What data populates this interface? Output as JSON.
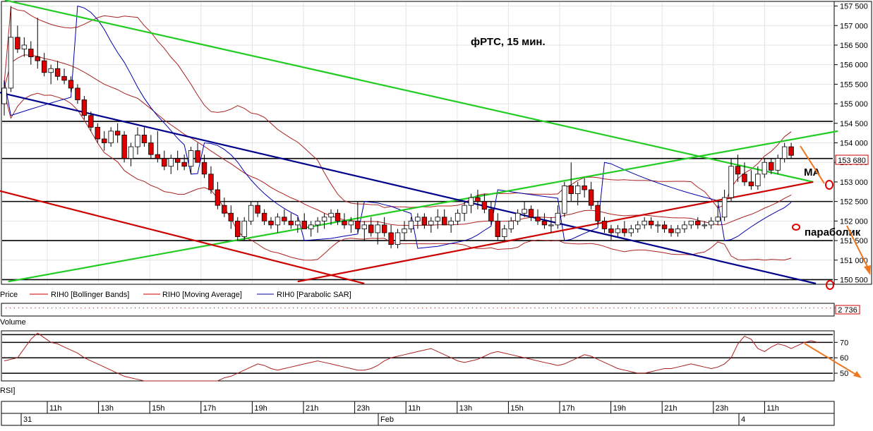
{
  "chart_data": {
    "type": "candlestick",
    "title": "фРТС,   15 мин.",
    "price_axis": {
      "ylim": [
        150400,
        157600
      ],
      "ticks": [
        157500,
        157000,
        156500,
        156000,
        155500,
        155000,
        154500,
        154000,
        153500,
        153000,
        152500,
        152000,
        151500,
        151000,
        150500
      ],
      "tick_labels": [
        "157 500",
        "157 000",
        "156 500",
        "156 000",
        "155 500",
        "155 000",
        "154 500",
        "154 000",
        "153 500",
        "153 000",
        "152 500",
        "152 000",
        "151 500",
        "151 000",
        "150 500"
      ],
      "last_price_label": "153 680",
      "last_price": 153680
    },
    "horizontal_levels": [
      154550,
      153600,
      152500,
      151500,
      150500
    ],
    "time_axis": {
      "hour_labels": [
        "11h",
        "13h",
        "15h",
        "17h",
        "19h",
        "21h",
        "23h",
        "11h",
        "13h",
        "15h",
        "17h",
        "19h",
        "21h",
        "23h",
        "11h"
      ],
      "date_labels": [
        "31",
        "Feb",
        "4"
      ]
    },
    "candles": [
      {
        "o": 155000,
        "h": 155600,
        "l": 154700,
        "c": 155400
      },
      {
        "o": 155400,
        "h": 157500,
        "l": 155300,
        "c": 156700
      },
      {
        "o": 156700,
        "h": 157000,
        "l": 156300,
        "c": 156400
      },
      {
        "o": 156400,
        "h": 156700,
        "l": 156200,
        "c": 156500
      },
      {
        "o": 156400,
        "h": 156600,
        "l": 156000,
        "c": 156200
      },
      {
        "o": 156200,
        "h": 157200,
        "l": 155900,
        "c": 156100
      },
      {
        "o": 156100,
        "h": 156300,
        "l": 155700,
        "c": 155800
      },
      {
        "o": 155800,
        "h": 156000,
        "l": 155500,
        "c": 155900
      },
      {
        "o": 155900,
        "h": 156100,
        "l": 155600,
        "c": 155700
      },
      {
        "o": 155700,
        "h": 155900,
        "l": 155500,
        "c": 155600
      },
      {
        "o": 155600,
        "h": 155700,
        "l": 155300,
        "c": 155400
      },
      {
        "o": 155400,
        "h": 155500,
        "l": 155000,
        "c": 155100
      },
      {
        "o": 155100,
        "h": 155200,
        "l": 154600,
        "c": 154700
      },
      {
        "o": 154700,
        "h": 154800,
        "l": 154300,
        "c": 154400
      },
      {
        "o": 154400,
        "h": 154500,
        "l": 154000,
        "c": 154100
      },
      {
        "o": 154100,
        "h": 154300,
        "l": 153800,
        "c": 154000
      },
      {
        "o": 154000,
        "h": 154400,
        "l": 153900,
        "c": 154300
      },
      {
        "o": 154300,
        "h": 154500,
        "l": 154000,
        "c": 154200
      },
      {
        "o": 154200,
        "h": 154300,
        "l": 153500,
        "c": 153600
      },
      {
        "o": 153600,
        "h": 154000,
        "l": 153400,
        "c": 153900
      },
      {
        "o": 153900,
        "h": 154400,
        "l": 153700,
        "c": 154200
      },
      {
        "o": 154200,
        "h": 154400,
        "l": 153900,
        "c": 154000
      },
      {
        "o": 154000,
        "h": 154200,
        "l": 153600,
        "c": 153700
      },
      {
        "o": 153700,
        "h": 154300,
        "l": 153500,
        "c": 153600
      },
      {
        "o": 153600,
        "h": 153800,
        "l": 153300,
        "c": 153400
      },
      {
        "o": 153400,
        "h": 153700,
        "l": 153200,
        "c": 153600
      },
      {
        "o": 153600,
        "h": 153800,
        "l": 153300,
        "c": 153500
      },
      {
        "o": 153500,
        "h": 153700,
        "l": 153300,
        "c": 153400
      },
      {
        "o": 153400,
        "h": 153900,
        "l": 153200,
        "c": 153800
      },
      {
        "o": 153800,
        "h": 154000,
        "l": 153500,
        "c": 153500
      },
      {
        "o": 153500,
        "h": 153700,
        "l": 153100,
        "c": 153200
      },
      {
        "o": 153200,
        "h": 153400,
        "l": 152700,
        "c": 152800
      },
      {
        "o": 152800,
        "h": 153000,
        "l": 152300,
        "c": 152400
      },
      {
        "o": 152400,
        "h": 152600,
        "l": 152100,
        "c": 152200
      },
      {
        "o": 152200,
        "h": 152400,
        "l": 151800,
        "c": 152000
      },
      {
        "o": 152000,
        "h": 152100,
        "l": 151500,
        "c": 151600
      },
      {
        "o": 151600,
        "h": 152100,
        "l": 151500,
        "c": 152000
      },
      {
        "o": 152000,
        "h": 152500,
        "l": 151900,
        "c": 152400
      },
      {
        "o": 152400,
        "h": 152500,
        "l": 152100,
        "c": 152200
      },
      {
        "o": 152200,
        "h": 152300,
        "l": 151900,
        "c": 152000
      },
      {
        "o": 152000,
        "h": 152100,
        "l": 151800,
        "c": 151900
      },
      {
        "o": 151900,
        "h": 152200,
        "l": 151700,
        "c": 152100
      },
      {
        "o": 152100,
        "h": 152300,
        "l": 151900,
        "c": 152000
      },
      {
        "o": 152000,
        "h": 152200,
        "l": 151800,
        "c": 151900
      },
      {
        "o": 151900,
        "h": 152100,
        "l": 151700,
        "c": 152000
      },
      {
        "o": 152000,
        "h": 152200,
        "l": 151800,
        "c": 151800
      },
      {
        "o": 151800,
        "h": 152000,
        "l": 151600,
        "c": 151900
      },
      {
        "o": 151900,
        "h": 152100,
        "l": 151700,
        "c": 152000
      },
      {
        "o": 152000,
        "h": 152200,
        "l": 151800,
        "c": 152100
      },
      {
        "o": 152100,
        "h": 152300,
        "l": 151900,
        "c": 152200
      },
      {
        "o": 152200,
        "h": 152300,
        "l": 151900,
        "c": 152000
      },
      {
        "o": 152000,
        "h": 152200,
        "l": 151800,
        "c": 151900
      },
      {
        "o": 151900,
        "h": 152100,
        "l": 151700,
        "c": 152000
      },
      {
        "o": 152000,
        "h": 152500,
        "l": 151700,
        "c": 151800
      },
      {
        "o": 151800,
        "h": 152000,
        "l": 151500,
        "c": 151900
      },
      {
        "o": 151900,
        "h": 152100,
        "l": 151600,
        "c": 151700
      },
      {
        "o": 151700,
        "h": 152000,
        "l": 151400,
        "c": 151900
      },
      {
        "o": 151900,
        "h": 152100,
        "l": 151600,
        "c": 151700
      },
      {
        "o": 151700,
        "h": 151900,
        "l": 151300,
        "c": 151400
      },
      {
        "o": 151400,
        "h": 151800,
        "l": 151300,
        "c": 151700
      },
      {
        "o": 151700,
        "h": 152000,
        "l": 151500,
        "c": 151800
      },
      {
        "o": 151800,
        "h": 152100,
        "l": 151700,
        "c": 152000
      },
      {
        "o": 152000,
        "h": 152200,
        "l": 151800,
        "c": 152100
      },
      {
        "o": 152100,
        "h": 152200,
        "l": 151800,
        "c": 151900
      },
      {
        "o": 151900,
        "h": 152100,
        "l": 151700,
        "c": 152000
      },
      {
        "o": 152000,
        "h": 152300,
        "l": 151800,
        "c": 152100
      },
      {
        "o": 152100,
        "h": 152300,
        "l": 151900,
        "c": 151900
      },
      {
        "o": 151900,
        "h": 152100,
        "l": 151700,
        "c": 152000
      },
      {
        "o": 152000,
        "h": 152300,
        "l": 151900,
        "c": 152200
      },
      {
        "o": 152200,
        "h": 152500,
        "l": 152000,
        "c": 152400
      },
      {
        "o": 152400,
        "h": 152700,
        "l": 152200,
        "c": 152600
      },
      {
        "o": 152600,
        "h": 152800,
        "l": 152300,
        "c": 152500
      },
      {
        "o": 152500,
        "h": 152700,
        "l": 152200,
        "c": 152300
      },
      {
        "o": 152300,
        "h": 152500,
        "l": 151900,
        "c": 152000
      },
      {
        "o": 152000,
        "h": 152200,
        "l": 151500,
        "c": 151600
      },
      {
        "o": 151600,
        "h": 151900,
        "l": 151500,
        "c": 151800
      },
      {
        "o": 151800,
        "h": 152100,
        "l": 151700,
        "c": 152000
      },
      {
        "o": 152000,
        "h": 152300,
        "l": 151900,
        "c": 152200
      },
      {
        "o": 152200,
        "h": 152500,
        "l": 152100,
        "c": 152300
      },
      {
        "o": 152300,
        "h": 152400,
        "l": 152000,
        "c": 152100
      },
      {
        "o": 152100,
        "h": 152300,
        "l": 151900,
        "c": 152000
      },
      {
        "o": 152000,
        "h": 152200,
        "l": 151800,
        "c": 151900
      },
      {
        "o": 151900,
        "h": 152100,
        "l": 151700,
        "c": 151900
      },
      {
        "o": 151900,
        "h": 152400,
        "l": 151800,
        "c": 152200
      },
      {
        "o": 152200,
        "h": 153000,
        "l": 152100,
        "c": 152900
      },
      {
        "o": 152900,
        "h": 153500,
        "l": 152500,
        "c": 152700
      },
      {
        "o": 152700,
        "h": 153000,
        "l": 152400,
        "c": 152900
      },
      {
        "o": 152900,
        "h": 153100,
        "l": 152600,
        "c": 152800
      },
      {
        "o": 152800,
        "h": 153000,
        "l": 152300,
        "c": 152400
      },
      {
        "o": 152400,
        "h": 152500,
        "l": 151900,
        "c": 152000
      },
      {
        "o": 152000,
        "h": 152100,
        "l": 151700,
        "c": 151800
      },
      {
        "o": 151800,
        "h": 151900,
        "l": 151500,
        "c": 151700
      },
      {
        "o": 151700,
        "h": 151900,
        "l": 151600,
        "c": 151800
      },
      {
        "o": 151800,
        "h": 152000,
        "l": 151600,
        "c": 151700
      },
      {
        "o": 151700,
        "h": 151900,
        "l": 151600,
        "c": 151800
      },
      {
        "o": 151800,
        "h": 152000,
        "l": 151700,
        "c": 151900
      },
      {
        "o": 151900,
        "h": 152100,
        "l": 151800,
        "c": 152000
      },
      {
        "o": 152000,
        "h": 152100,
        "l": 151800,
        "c": 151900
      },
      {
        "o": 151900,
        "h": 152000,
        "l": 151700,
        "c": 151900
      },
      {
        "o": 151900,
        "h": 152000,
        "l": 151700,
        "c": 151800
      },
      {
        "o": 151800,
        "h": 151900,
        "l": 151600,
        "c": 151700
      },
      {
        "o": 151700,
        "h": 151900,
        "l": 151600,
        "c": 151800
      },
      {
        "o": 151800,
        "h": 152000,
        "l": 151700,
        "c": 151900
      },
      {
        "o": 151900,
        "h": 152000,
        "l": 151800,
        "c": 152000
      },
      {
        "o": 152000,
        "h": 152100,
        "l": 151800,
        "c": 151900
      },
      {
        "o": 151900,
        "h": 152000,
        "l": 151800,
        "c": 151900
      },
      {
        "o": 151900,
        "h": 152100,
        "l": 151800,
        "c": 152000
      },
      {
        "o": 152000,
        "h": 152400,
        "l": 151900,
        "c": 152100
      },
      {
        "o": 152100,
        "h": 152800,
        "l": 152000,
        "c": 152600
      },
      {
        "o": 152600,
        "h": 153600,
        "l": 152500,
        "c": 153400
      },
      {
        "o": 153400,
        "h": 153700,
        "l": 153000,
        "c": 153200
      },
      {
        "o": 153200,
        "h": 153500,
        "l": 152900,
        "c": 153000
      },
      {
        "o": 153000,
        "h": 153300,
        "l": 152800,
        "c": 152900
      },
      {
        "o": 152900,
        "h": 153400,
        "l": 152800,
        "c": 153200
      },
      {
        "o": 153200,
        "h": 153600,
        "l": 153100,
        "c": 153500
      },
      {
        "o": 153500,
        "h": 153600,
        "l": 153200,
        "c": 153300
      },
      {
        "o": 153300,
        "h": 153700,
        "l": 153200,
        "c": 153600
      },
      {
        "o": 153600,
        "h": 154000,
        "l": 153500,
        "c": 153900
      },
      {
        "o": 153900,
        "h": 154000,
        "l": 153600,
        "c": 153680
      }
    ],
    "trend_lines": [
      {
        "color": "#22cc22",
        "x0": 0.1,
        "y0": 157650,
        "x1": 121.3,
        "y1": 153000
      },
      {
        "color": "#22cc22",
        "x0": 0.6,
        "y0": 150450,
        "x1": 125,
        "y1": 154300
      },
      {
        "color": "#00008b",
        "x0": -6,
        "y0": 155500,
        "x1": 121.7,
        "y1": 150400
      },
      {
        "color": "#cc0000",
        "x0": -6,
        "y0": 153000,
        "x1": 54,
        "y1": 150400
      },
      {
        "color": "#cc0000",
        "x0": 44,
        "y0": 150450,
        "x1": 121.3,
        "y1": 153000
      }
    ],
    "legend": [
      "Price",
      "RIH0 [Bollinger Bands]",
      "RIH0 [Moving Average]",
      "RIH0 [Parabolic SAR]"
    ],
    "volume": {
      "label": "Volume",
      "last_label": "2 736",
      "last": 2736
    },
    "rsi": {
      "label": "RSI]",
      "ticks": [
        70,
        60,
        50
      ],
      "tick_labels": [
        "70",
        "60",
        "50"
      ],
      "levels": [
        75,
        70,
        60,
        50
      ],
      "values": [
        58,
        59,
        60,
        66,
        72,
        76,
        73,
        70,
        69,
        67,
        65,
        63,
        60,
        58,
        56,
        54,
        52,
        50,
        48,
        47,
        46,
        45,
        44,
        44,
        43,
        43,
        42,
        42,
        42,
        43,
        44,
        44,
        45,
        47,
        48,
        50,
        52,
        54,
        56,
        55,
        53,
        52,
        53,
        54,
        55,
        56,
        57,
        58,
        57,
        56,
        55,
        54,
        53,
        52,
        52,
        53,
        55,
        58,
        60,
        61,
        62,
        63,
        64,
        65,
        66,
        64,
        62,
        60,
        58,
        57,
        58,
        59,
        61,
        63,
        64,
        63,
        62,
        61,
        60,
        59,
        58,
        57,
        56,
        55,
        56,
        58,
        60,
        62,
        61,
        59,
        57,
        55,
        53,
        52,
        51,
        50,
        50,
        51,
        52,
        53,
        53,
        54,
        55,
        56,
        55,
        54,
        53,
        54,
        56,
        60,
        69,
        74,
        72,
        66,
        64,
        67,
        69,
        68,
        66,
        68,
        70,
        71,
        70
      ]
    },
    "annotations": [
      {
        "text": "МА"
      },
      {
        "text": "параболик"
      }
    ]
  }
}
